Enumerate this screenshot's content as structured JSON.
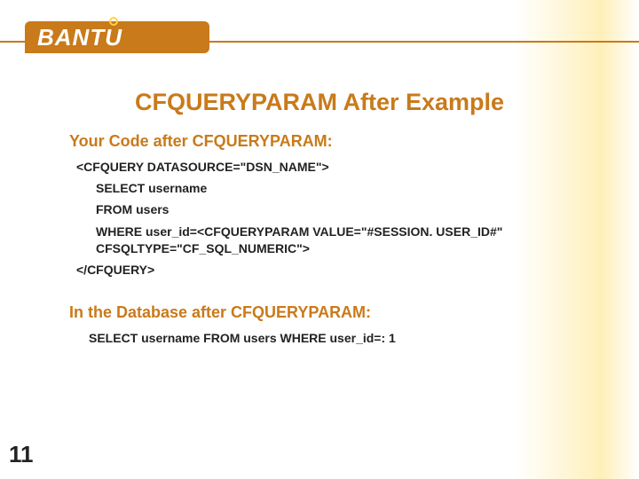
{
  "logo": {
    "text_part1": "BANT",
    "text_part2": "U"
  },
  "slide": {
    "title": "CFQUERYPARAM After Example",
    "page_number": "11"
  },
  "section1": {
    "heading": "Your Code after CFQUERYPARAM:",
    "line_open": "<CFQUERY DATASOURCE=\"DSN_NAME\">",
    "line_select": "SELECT username",
    "line_from": "FROM users",
    "line_where_a": "WHERE user_id=<CFQUERYPARAM VALUE=\"#SESSION. USER_ID#\"",
    "line_where_b": "CFSQLTYPE=\"CF_SQL_NUMERIC\">",
    "line_close": "</CFQUERY>"
  },
  "section2": {
    "heading": "In the Database after CFQUERYPARAM:",
    "line": "SELECT username FROM users WHERE user_id=: 1"
  }
}
